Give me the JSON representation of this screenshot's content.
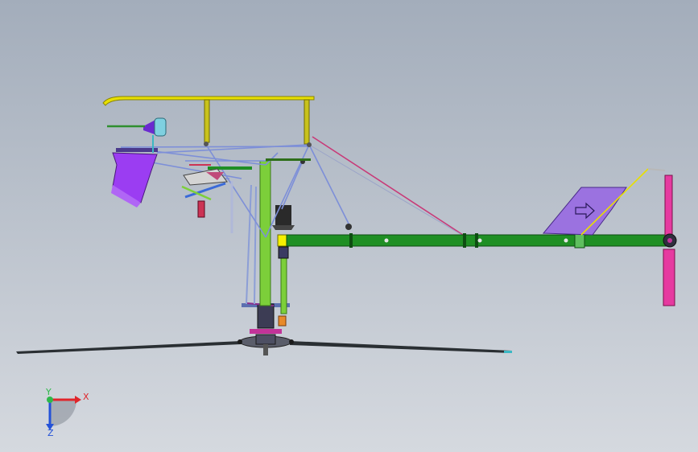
{
  "viewport": {
    "background_top": "#a3adbb",
    "background_bottom": "#d5d9df"
  },
  "colors": {
    "tail_boom": "#1f8f24",
    "mast": "#7ccf3a",
    "top_bar": "#e8e000",
    "seat": "#9b3df2",
    "fin": "#9b72e0",
    "tail_rotor": "#e63aa0",
    "frame_lines": "#7d8fd8",
    "brace_red": "#c83a78",
    "rotor_blade": "#2a2f33"
  },
  "icons": {
    "fin_arrow": "right-arrow-icon",
    "triad": "coordinate-triad-icon"
  },
  "triad": {
    "x_label": "X",
    "y_label": "Y",
    "z_label": "Z",
    "x_color": "#e0262b",
    "y_color": "#2fb84a",
    "z_color": "#2452d8"
  }
}
